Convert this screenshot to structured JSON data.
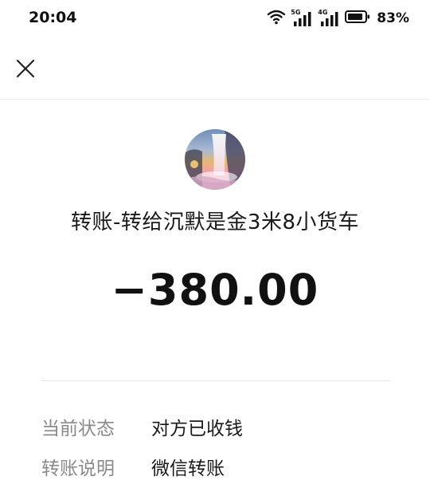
{
  "status_bar": {
    "time": "20:04",
    "network_5g": "5G",
    "network_4g": "4G",
    "battery_percent": "83%"
  },
  "nav": {
    "close_icon": "close-icon"
  },
  "transfer": {
    "title": "转账-转给沉默是金3米8小货车",
    "amount": "−380.00"
  },
  "details": [
    {
      "label": "当前状态",
      "value": "对方已收钱"
    },
    {
      "label": "转账说明",
      "value": "微信转账"
    }
  ]
}
